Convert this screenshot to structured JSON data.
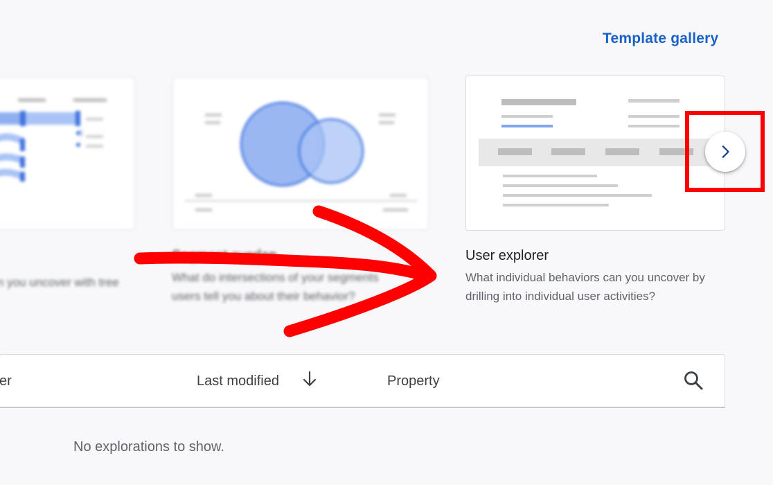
{
  "header": {
    "template_gallery_label": "Template gallery"
  },
  "cards": [
    {
      "title": "",
      "description": "n you uncover with tree"
    },
    {
      "title": "Segment overlap",
      "description": "What do intersections of your segments users tell you about their behavior?"
    },
    {
      "title": "User explorer",
      "description": "What individual behaviors can you uncover by drilling into individual user activities?"
    }
  ],
  "carousel": {
    "next_icon": "chevron-right-icon"
  },
  "table": {
    "columns": {
      "owner": "er",
      "last_modified": "Last modified",
      "property": "Property"
    },
    "sort_icon": "arrow-down-icon",
    "search_icon": "search-icon",
    "empty_message": "No explorations to show."
  },
  "colors": {
    "accent": "#1a62c8",
    "annotation": "#ff0000",
    "venn": "#4a80e8"
  }
}
